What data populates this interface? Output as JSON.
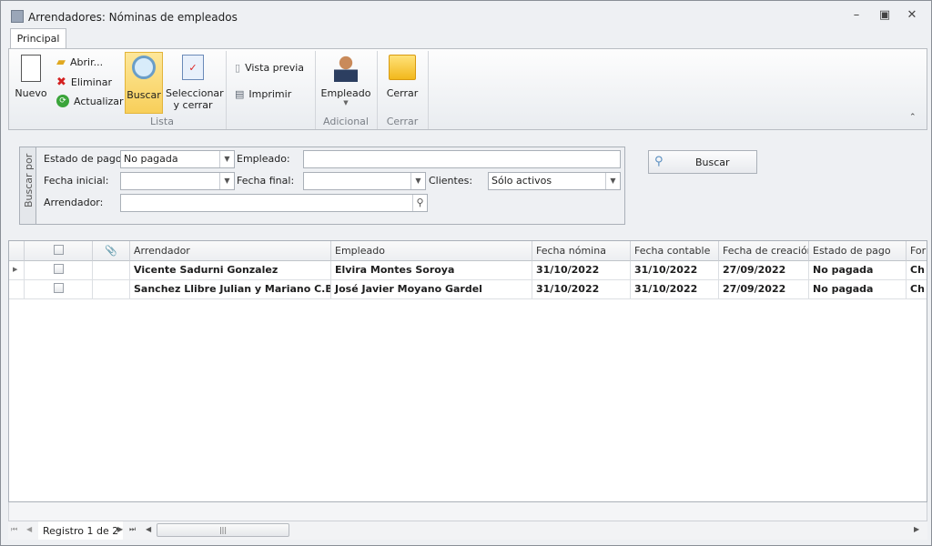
{
  "window": {
    "title": "Arrendadores: Nóminas de empleados"
  },
  "ribbon": {
    "tab": "Principal",
    "buttons": {
      "nuevo": "Nuevo",
      "abrir": "Abrir...",
      "eliminar": "Eliminar",
      "actualizar": "Actualizar",
      "buscar": "Buscar",
      "seleccionar1": "Seleccionar",
      "seleccionar2": "y cerrar",
      "vista_previa": "Vista previa",
      "imprimir": "Imprimir",
      "empleado": "Empleado",
      "cerrar": "Cerrar"
    },
    "groups": {
      "lista": "Lista",
      "adicional": "Adicional",
      "cerrar": "Cerrar"
    }
  },
  "search": {
    "legend": "Buscar por",
    "estado_label": "Estado de pago:",
    "estado_value": "No pagada",
    "empleado_label": "Empleado:",
    "empleado_value": "",
    "fecha_inicial_label": "Fecha inicial:",
    "fecha_final_label": "Fecha final:",
    "clientes_label": "Clientes:",
    "clientes_value": "Sólo activos",
    "arrendador_label": "Arrendador:",
    "arrendador_value": "",
    "buscar_button": "Buscar"
  },
  "grid": {
    "columns": [
      "Arrendador",
      "Empleado",
      "Fecha nómina",
      "Fecha contable",
      "Fecha de creación",
      "Estado de pago",
      "For"
    ],
    "rows": [
      [
        "Vicente Sadurni Gonzalez",
        "Elvira Montes Soroya",
        "31/10/2022",
        "31/10/2022",
        "27/09/2022",
        "No pagada",
        "Ch"
      ],
      [
        "Sanchez Llibre Julian y Mariano C.B.",
        "José Javier Moyano Gardel",
        "31/10/2022",
        "31/10/2022",
        "27/09/2022",
        "No pagada",
        "Ch"
      ]
    ]
  },
  "navigator": {
    "record": "Registro 1 de 2"
  }
}
